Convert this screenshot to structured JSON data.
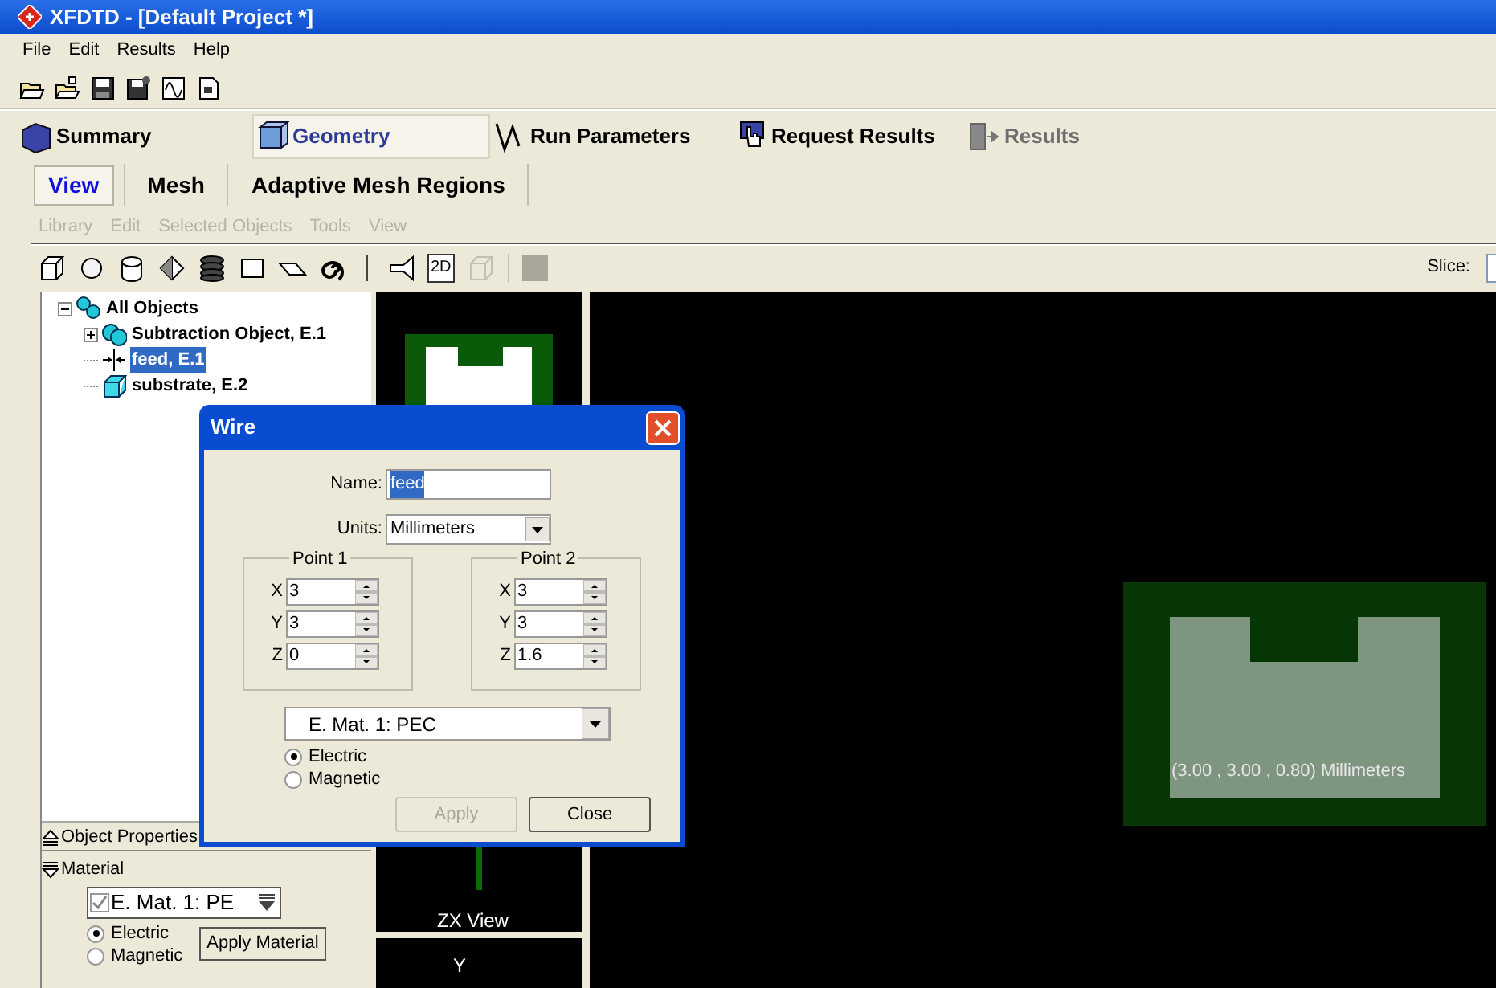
{
  "window": {
    "title": "XFDTD - [Default Project *]"
  },
  "menu": [
    "File",
    "Edit",
    "Results",
    "Help"
  ],
  "main_tabs": [
    {
      "label": "Summary",
      "selected": false,
      "disabled": false
    },
    {
      "label": "Geometry",
      "selected": true,
      "disabled": false
    },
    {
      "label": "Run Parameters",
      "selected": false,
      "disabled": false
    },
    {
      "label": "Request Results",
      "selected": false,
      "disabled": false
    },
    {
      "label": "Results",
      "selected": false,
      "disabled": true
    }
  ],
  "sub_tabs": [
    {
      "label": "View",
      "selected": true
    },
    {
      "label": "Mesh",
      "selected": false
    },
    {
      "label": "Adaptive Mesh Regions",
      "selected": false
    }
  ],
  "geometry_menu": [
    {
      "label": "Library",
      "disabled": true
    },
    {
      "label": "Edit",
      "disabled": true
    },
    {
      "label": "Selected Objects",
      "disabled": true
    },
    {
      "label": "Tools",
      "disabled": true
    },
    {
      "label": "View",
      "disabled": true
    }
  ],
  "shape_toolbar": {
    "view_2d": "2D",
    "slice_label": "Slice:"
  },
  "tree": [
    {
      "label": "All Objects",
      "kind": "group",
      "expanded": true,
      "selected": false,
      "children": [
        {
          "label": "Subtraction Object, E.1",
          "kind": "subtraction",
          "expanded": false,
          "selected": false
        },
        {
          "label": "feed, E.1",
          "kind": "wire",
          "selected": true
        },
        {
          "label": "substrate, E.2",
          "kind": "box",
          "selected": false
        }
      ]
    }
  ],
  "object_properties": {
    "title": "Object Properties",
    "material_title": "Material",
    "material": "E. Mat. 1: PE",
    "checked": true,
    "types": [
      {
        "label": "Electric",
        "selected": true
      },
      {
        "label": "Magnetic",
        "selected": false
      }
    ],
    "apply_button": "Apply Material"
  },
  "views": {
    "zx_label": "ZX View",
    "lower_axis_label": "Y",
    "readout": "(3.00 , 3.00 , 0.80) Millimeters"
  },
  "dialog": {
    "title": "Wire",
    "name_label": "Name:",
    "name": "feed",
    "name_selected": true,
    "units_label": "Units:",
    "units": "Millimeters",
    "points": [
      {
        "title": "Point 1",
        "coords": [
          {
            "axis": "X",
            "value": "3"
          },
          {
            "axis": "Y",
            "value": "3"
          },
          {
            "axis": "Z",
            "value": "0"
          }
        ]
      },
      {
        "title": "Point 2",
        "coords": [
          {
            "axis": "X",
            "value": "3"
          },
          {
            "axis": "Y",
            "value": "3"
          },
          {
            "axis": "Z",
            "value": "1.6"
          }
        ]
      }
    ],
    "material": "E. Mat. 1: PEC",
    "types": [
      {
        "label": "Electric",
        "selected": true
      },
      {
        "label": "Magnetic",
        "selected": false
      }
    ],
    "buttons": [
      {
        "label": "Apply",
        "disabled": true
      },
      {
        "label": "Close",
        "disabled": false
      }
    ]
  }
}
